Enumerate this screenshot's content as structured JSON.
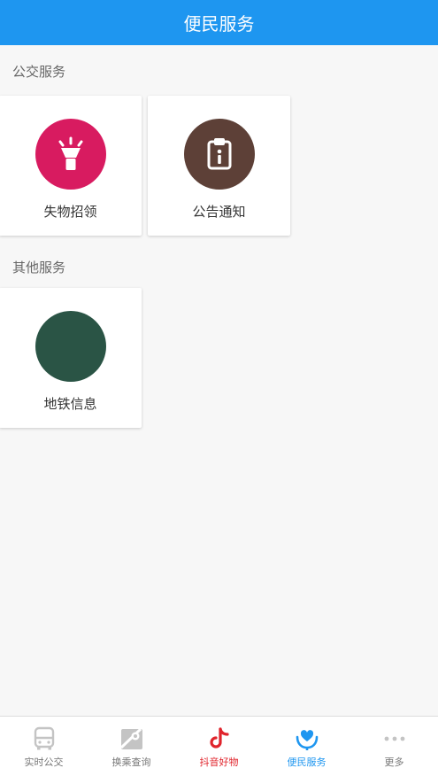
{
  "header": {
    "title": "便民服务"
  },
  "sections": [
    {
      "title": "公交服务",
      "items": [
        {
          "label": "失物招领",
          "icon": "flashlight-icon",
          "color": "#d81b60"
        },
        {
          "label": "公告通知",
          "icon": "clipboard-info-icon",
          "color": "#5d4037"
        }
      ]
    },
    {
      "title": "其他服务",
      "items": [
        {
          "label": "地铁信息",
          "icon": "subway-icon",
          "color": "#2a5445"
        }
      ]
    }
  ],
  "tabbar": {
    "tabs": [
      {
        "label": "实时公交",
        "icon": "bus-icon",
        "color": "#777777"
      },
      {
        "label": "换乘查询",
        "icon": "map-route-icon",
        "color": "#777777"
      },
      {
        "label": "抖音好物",
        "icon": "tiktok-icon",
        "color": "#e0242c"
      },
      {
        "label": "便民服务",
        "icon": "heart-hand-icon",
        "color": "#1e96f0",
        "active": true
      },
      {
        "label": "更多",
        "icon": "more-dots-icon",
        "color": "#777777"
      }
    ]
  },
  "colors": {
    "primary": "#1e96f0",
    "background": "#f7f7f7"
  }
}
